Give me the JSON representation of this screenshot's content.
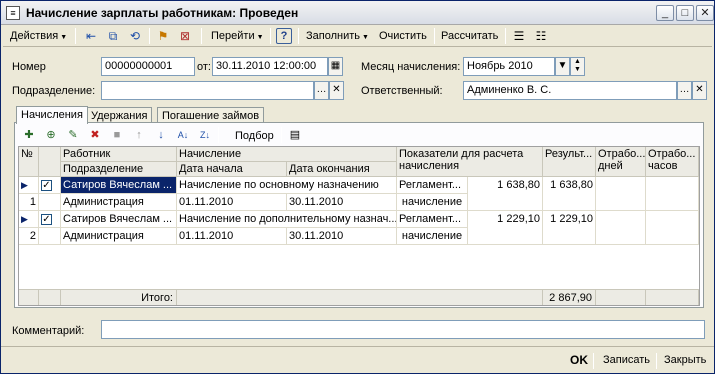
{
  "window": {
    "title": "Начисление зарплаты работникам: Проведен",
    "app_icon": "document-icon"
  },
  "toolbar": {
    "actions": "Действия",
    "goto": "Перейти",
    "fill": "Заполнить",
    "clear": "Очистить",
    "calculate": "Рассчитать",
    "help": "?"
  },
  "form": {
    "number_label": "Номер",
    "number_value": "00000000001",
    "date_label": "от:",
    "date_value": "30.11.2010 12:00:00",
    "month_label": "Месяц начисления:",
    "month_value": "Ноябрь 2010",
    "department_label": "Подразделение:",
    "department_value": "",
    "responsible_label": "Ответственный:",
    "responsible_value": "Админенко В. С.",
    "comment_label": "Комментарий:",
    "comment_value": ""
  },
  "tabs": [
    "Начисления",
    "Удержания",
    "Погашение займов"
  ],
  "grid_toolbar": {
    "selection": "Подбор"
  },
  "grid": {
    "headers": {
      "no": "№",
      "worker": "Работник",
      "department": "Подразделение",
      "accrual": "Начисление",
      "date_start": "Дата начала",
      "date_end": "Дата окончания",
      "indicators": "Показатели для расчета начисления",
      "result": "Результ...",
      "days": "Отрабо... дней",
      "hours": "Отрабо... часов"
    },
    "rows": [
      {
        "no": "1",
        "worker": "Сатиров Вячеслам ...",
        "department": "Администрация",
        "accrual": "Начисление по основному назначению",
        "date_start": "01.11.2010",
        "date_end": "30.11.2010",
        "indicator_name": "Регламент...",
        "indicator_sub": "начисление",
        "indicator_value": "1 638,80",
        "result": "1 638,80"
      },
      {
        "no": "2",
        "worker": "Сатиров Вячеслам ...",
        "department": "Администрация",
        "accrual": "Начисление по дополнительному назнач...",
        "date_start": "01.11.2010",
        "date_end": "30.11.2010",
        "indicator_name": "Регламент...",
        "indicator_sub": "начисление",
        "indicator_value": "1 229,10",
        "result": "1 229,10"
      }
    ],
    "footer": {
      "total_label": "Итого:",
      "total_value": "2 867,90"
    }
  },
  "buttons": {
    "ok": "OK",
    "save": "Записать",
    "close": "Закрыть"
  }
}
